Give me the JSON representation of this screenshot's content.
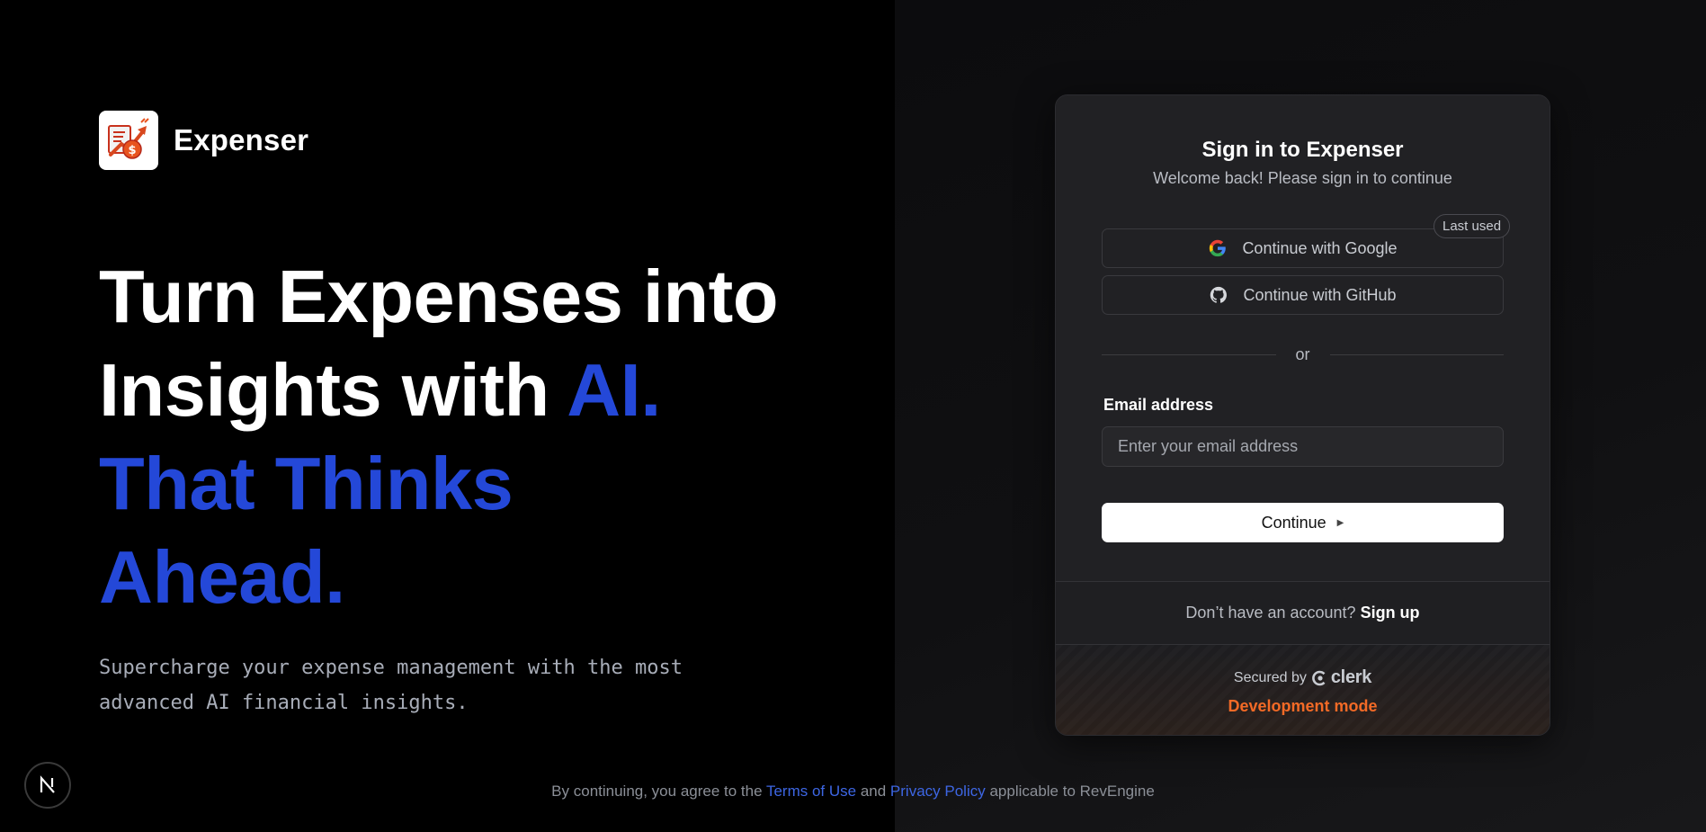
{
  "brand": {
    "name": "Expenser",
    "logo_icon": "expense-chart-logo-icon"
  },
  "hero": {
    "headline_line1": "Turn Expenses into",
    "headline_line2_white": "Insights with ",
    "headline_line2_accent": "AI.",
    "headline_line3": "That Thinks",
    "headline_line4": "Ahead.",
    "subtitle_line1": "Supercharge your expense management with the most",
    "subtitle_line2": "advanced AI financial insights.",
    "accent_color": "#2448d8"
  },
  "next_badge": {
    "letter": "N",
    "icon": "nextjs-icon"
  },
  "signin": {
    "title": "Sign in to Expenser",
    "subtitle": "Welcome back! Please sign in to continue",
    "google_label": "Continue with Google",
    "google_icon": "google-icon",
    "github_label": "Continue with GitHub",
    "github_icon": "github-icon",
    "last_used_badge": "Last used",
    "divider_text": "or",
    "email_label": "Email address",
    "email_placeholder": "Enter your email address",
    "email_value": "",
    "continue_label": "Continue",
    "continue_icon": "play-arrow-icon",
    "signup_prompt": "Don’t have an account?",
    "signup_link": "Sign up",
    "secured_by": "Secured by",
    "clerk_word": "clerk",
    "dev_mode": "Development mode",
    "dev_mode_color": "#f36a26"
  },
  "footer": {
    "prefix": "By continuing, you agree to the ",
    "terms_link": "Terms of Use",
    "and_text": " and ",
    "privacy_link": "Privacy Policy",
    "suffix": " applicable to RevEngine",
    "link_color": "#3d66e3"
  }
}
